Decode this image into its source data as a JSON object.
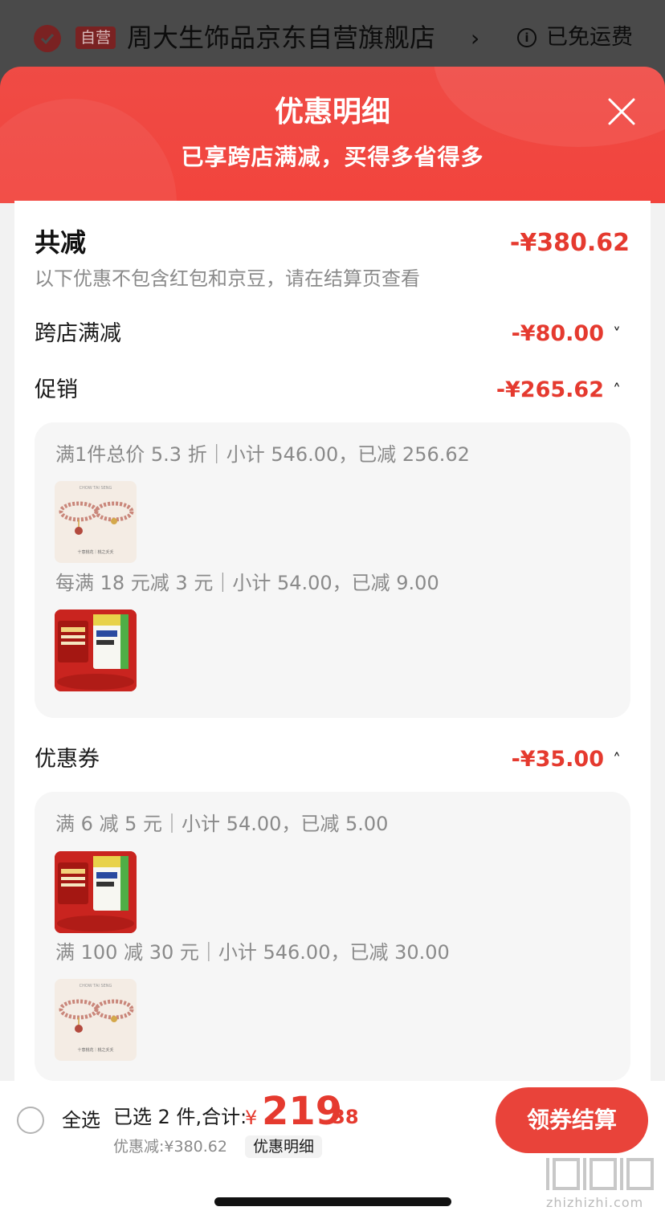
{
  "store": {
    "tag": "自营",
    "name": "周大生饰品京东自营旗舰店",
    "chevron": "›",
    "shipping_icon": "i",
    "shipping": "已免运费"
  },
  "sheet": {
    "title": "优惠明细",
    "subtitle": "已享跨店满减，买得多省得多"
  },
  "summary": {
    "title": "共减",
    "amount": "-¥380.62",
    "note": "以下优惠不包含红包和京豆，请在结算页查看"
  },
  "sections": [
    {
      "label": "跨店满减",
      "amount": "-¥80.00",
      "chevron": "˅",
      "expanded": false
    },
    {
      "label": "促销",
      "amount": "-¥265.62",
      "chevron": "˄",
      "expanded": true,
      "rules": [
        {
          "text": "满1件总价 5.3 折｜小计 546.00，已减 256.62",
          "thumb": "bracelet"
        },
        {
          "text": "每满 18 元减 3 元｜小计 54.00，已减 9.00",
          "thumb": "product"
        }
      ]
    },
    {
      "label": "优惠券",
      "amount": "-¥35.00",
      "chevron": "˄",
      "expanded": true,
      "rules": [
        {
          "text": "满 6 减 5 元｜小计 54.00，已减 5.00",
          "thumb": "product"
        },
        {
          "text": "满 100 减 30 元｜小计 546.00，已减 30.00",
          "thumb": "bracelet"
        }
      ]
    }
  ],
  "thumb_text": {
    "bracelet_brand": "CHOW TAI SENG",
    "bracelet_tagline": "十意桃花｜桃之夭夭"
  },
  "bottom": {
    "select_all": "全选",
    "selected": "已选 2 件,合计:",
    "currency": "¥",
    "price_int": "219",
    "price_dec": ".38",
    "discount": "优惠减:¥380.62",
    "detail_chip": "优惠明细",
    "checkout": "领券结算"
  },
  "watermark": {
    "text": "zhizhizhi.com"
  },
  "colors": {
    "accent_red": "#e53a2f",
    "header_red": "#ef4b45",
    "button_red": "#e9433a",
    "muted_text": "#8a8a8a"
  }
}
